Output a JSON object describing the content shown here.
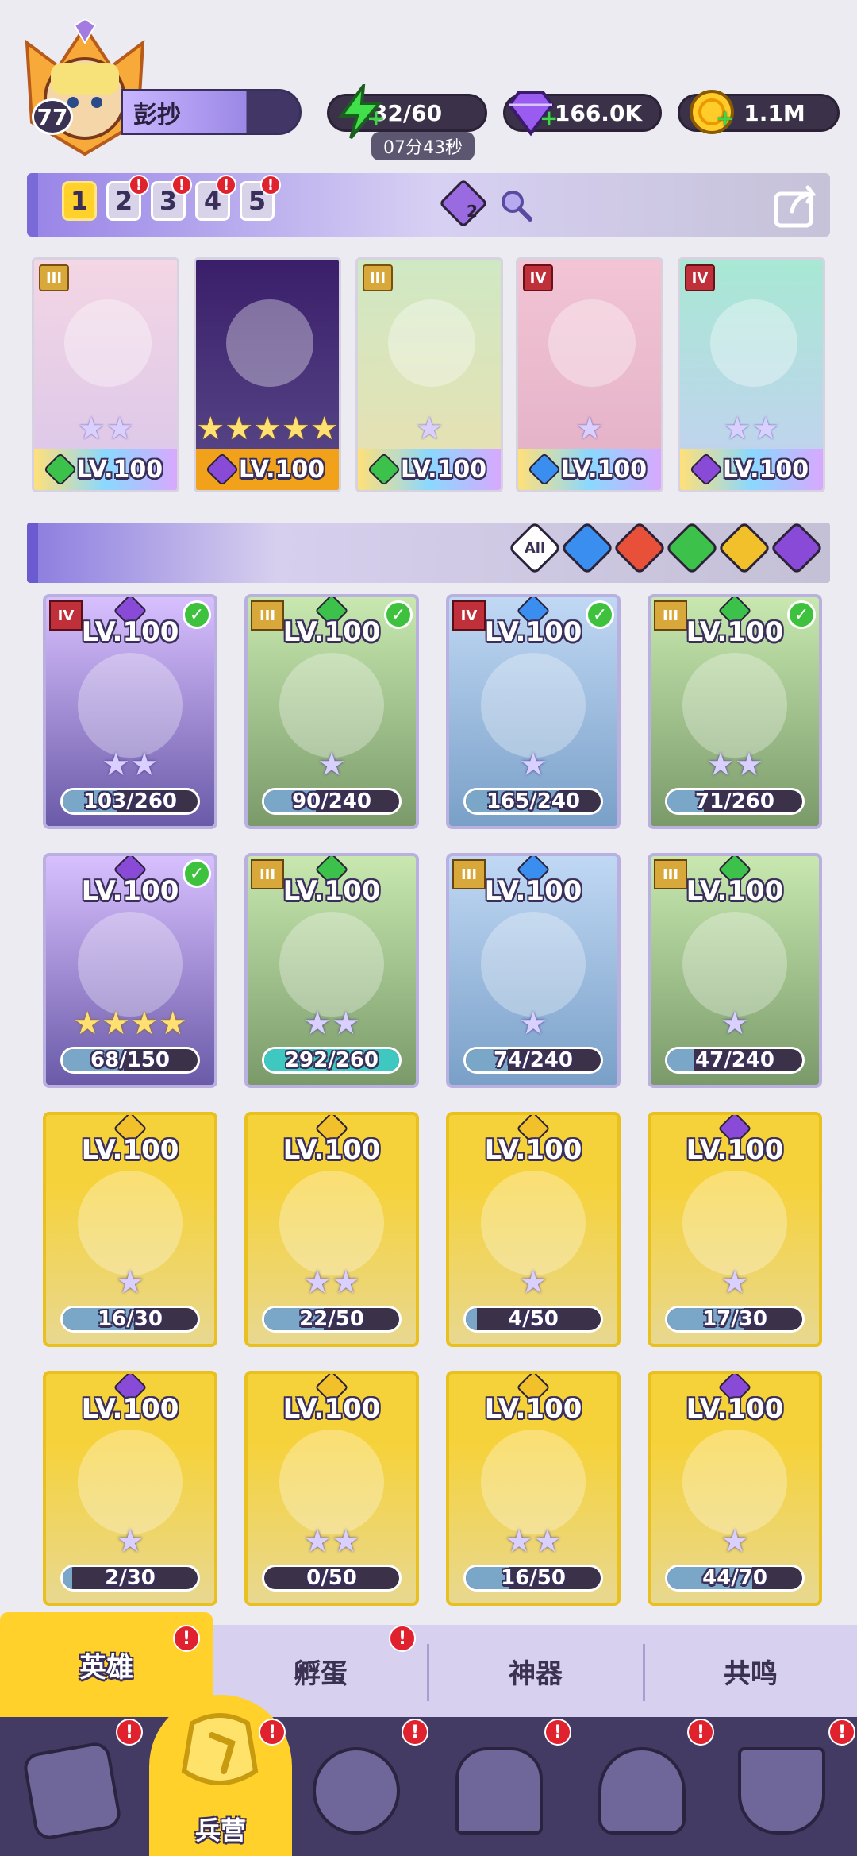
{
  "player": {
    "level": "77",
    "name": "彭抄"
  },
  "resources": {
    "energy": "32/60",
    "energy_timer": "07分43秒",
    "gems": "166.0K",
    "gold": "1.1M",
    "plus": "+"
  },
  "teams": {
    "tabs": [
      "1",
      "2",
      "3",
      "4",
      "5"
    ],
    "active": "1",
    "mark": "!",
    "extra_count": "2"
  },
  "team_cards": [
    {
      "tier": "III",
      "level": "LV.100",
      "stars": "★★",
      "element": "green"
    },
    {
      "tier": "",
      "level": "LV.100",
      "stars": "★★★★★",
      "element": "purple"
    },
    {
      "tier": "III",
      "level": "LV.100",
      "stars": "★",
      "element": "green"
    },
    {
      "tier": "IV",
      "level": "LV.100",
      "stars": "★",
      "element": "blue"
    },
    {
      "tier": "IV",
      "level": "LV.100",
      "stars": "★★",
      "element": "purple"
    }
  ],
  "filter": {
    "all_label": "All",
    "elements": [
      "water",
      "fire",
      "nature",
      "light",
      "dark"
    ]
  },
  "hero_cards": [
    {
      "tier": "IV",
      "level": "LV.100",
      "progress": "103/260",
      "fraction": 0.4,
      "stars": "★★",
      "check": true,
      "element": "purple"
    },
    {
      "tier": "III",
      "level": "LV.100",
      "progress": "90/240",
      "fraction": 0.38,
      "stars": "★",
      "check": true,
      "element": "green"
    },
    {
      "tier": "IV",
      "level": "LV.100",
      "progress": "165/240",
      "fraction": 0.69,
      "stars": "★",
      "check": true,
      "element": "blue"
    },
    {
      "tier": "III",
      "level": "LV.100",
      "progress": "71/260",
      "fraction": 0.27,
      "stars": "★★",
      "check": true,
      "element": "green"
    },
    {
      "tier": "",
      "level": "LV.100",
      "progress": "68/150",
      "fraction": 0.45,
      "stars": "★★★★",
      "check": true,
      "element": "purple"
    },
    {
      "tier": "III",
      "level": "LV.100",
      "progress": "292/260",
      "fraction": 1.0,
      "stars": "★★",
      "check": false,
      "element": "green"
    },
    {
      "tier": "III",
      "level": "LV.100",
      "progress": "74/240",
      "fraction": 0.31,
      "stars": "★",
      "check": false,
      "element": "blue"
    },
    {
      "tier": "III",
      "level": "LV.100",
      "progress": "47/240",
      "fraction": 0.2,
      "stars": "★",
      "check": false,
      "element": "green"
    },
    {
      "tier": "",
      "level": "LV.100",
      "progress": "16/30",
      "fraction": 0.53,
      "stars": "★",
      "check": false,
      "element": "yellow"
    },
    {
      "tier": "",
      "level": "LV.100",
      "progress": "22/50",
      "fraction": 0.44,
      "stars": "★★",
      "check": false,
      "element": "yellow"
    },
    {
      "tier": "",
      "level": "LV.100",
      "progress": "4/50",
      "fraction": 0.08,
      "stars": "★",
      "check": false,
      "element": "yellow"
    },
    {
      "tier": "",
      "level": "LV.100",
      "progress": "17/30",
      "fraction": 0.57,
      "stars": "★",
      "check": false,
      "element": "purple"
    },
    {
      "tier": "",
      "level": "LV.100",
      "progress": "2/30",
      "fraction": 0.07,
      "stars": "★",
      "check": false,
      "element": "purple"
    },
    {
      "tier": "",
      "level": "LV.100",
      "progress": "0/50",
      "fraction": 0.0,
      "stars": "★★",
      "check": false,
      "element": "yellow"
    },
    {
      "tier": "",
      "level": "LV.100",
      "progress": "16/50",
      "fraction": 0.32,
      "stars": "★★",
      "check": false,
      "element": "yellow"
    },
    {
      "tier": "",
      "level": "LV.100",
      "progress": "44/70",
      "fraction": 0.63,
      "stars": "★",
      "check": false,
      "element": "purple"
    }
  ],
  "tabs": {
    "heroes": "英雄",
    "hatch": "孵蛋",
    "artifacts": "神器",
    "resonance": "共鸣"
  },
  "nav": {
    "barracks": "兵营"
  },
  "colors": {
    "accent": "#ffd12a",
    "badge": "#e0222e",
    "purple": "#9b88e6"
  }
}
